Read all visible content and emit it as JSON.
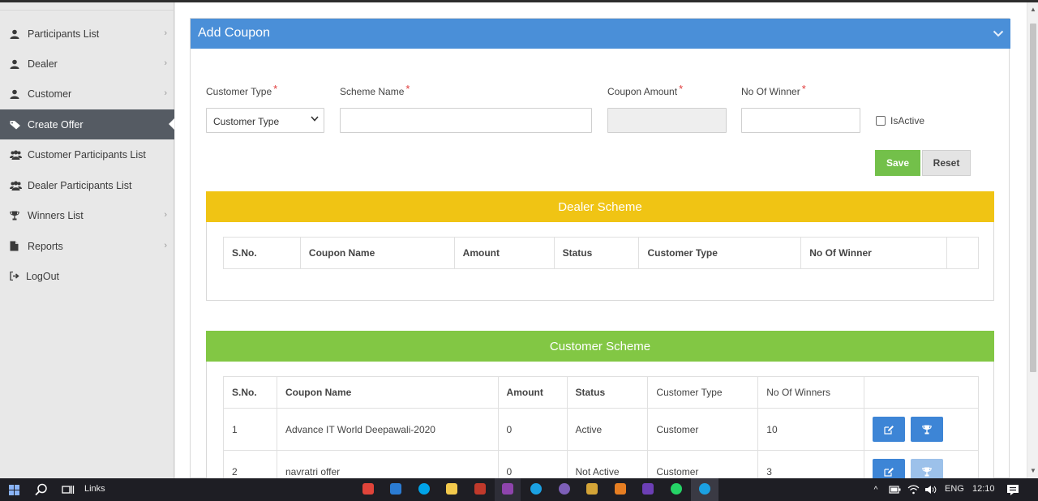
{
  "sidebar": {
    "items": [
      {
        "label": "Participants List",
        "icon": "user-icon",
        "chevron": "›"
      },
      {
        "label": "Dealer",
        "icon": "user-icon",
        "chevron": "›"
      },
      {
        "label": "Customer",
        "icon": "user-icon",
        "chevron": "›"
      },
      {
        "label": "Create Offer",
        "icon": "tags-icon",
        "active": true
      },
      {
        "label": "Customer Participants List",
        "icon": "users-icon"
      },
      {
        "label": "Dealer Participants List",
        "icon": "users-icon"
      },
      {
        "label": "Winners List",
        "icon": "trophy-icon",
        "chevron": "›"
      },
      {
        "label": "Reports",
        "icon": "file-icon",
        "chevron": "›"
      },
      {
        "label": "LogOut",
        "icon": "logout-icon"
      }
    ]
  },
  "form": {
    "title": "Add Coupon",
    "collapse_icon": "chevron-down-icon",
    "customer_type_label": "Customer Type",
    "customer_type_value": "Customer Type",
    "scheme_name_label": "Scheme Name",
    "scheme_name_value": "",
    "coupon_amount_label": "Coupon Amount",
    "coupon_amount_value": "",
    "winners_label": "No Of Winner",
    "winners_value": "",
    "required_mark": "*",
    "isactive_label": "IsActive",
    "save_label": "Save",
    "reset_label": "Reset"
  },
  "dealer_scheme": {
    "title": "Dealer Scheme",
    "color": "#f0c414",
    "columns": [
      "S.No.",
      "Coupon Name",
      "Amount",
      "Status",
      "Customer Type",
      "No Of Winner",
      ""
    ]
  },
  "customer_scheme": {
    "title": "Customer Scheme",
    "color": "#82c744",
    "columns": [
      "S.No.",
      "Coupon Name",
      "Amount",
      "Status",
      "Customer Type",
      "No Of Winners",
      ""
    ],
    "rows": [
      {
        "sno": "1",
        "name": "Advance IT World Deepawali-2020",
        "amount": "0",
        "status": "Active",
        "customer_type": "Customer",
        "winners": "10"
      },
      {
        "sno": "2",
        "name": "navratri offer",
        "amount": "0",
        "status": "Not Active",
        "customer_type": "Customer",
        "winners": "3"
      }
    ]
  },
  "taskbar": {
    "links_label": "Links",
    "language": "ENG",
    "time": "12:10"
  }
}
